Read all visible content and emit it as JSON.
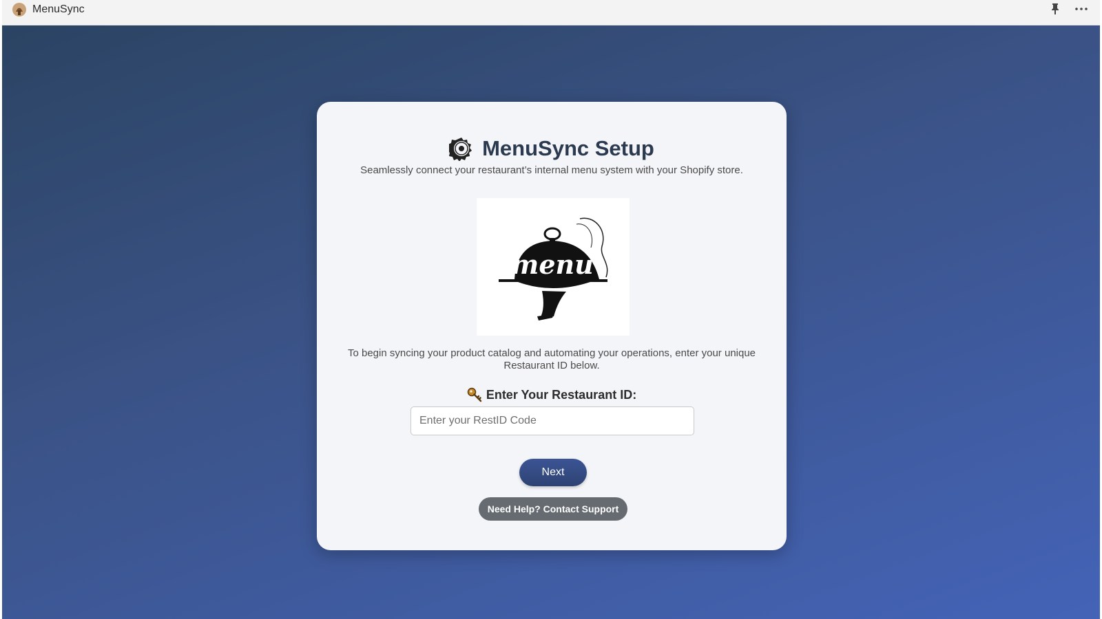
{
  "window": {
    "title": "MenuSync",
    "logo_icon": "app-logo-icon",
    "pin_icon": "pin-icon",
    "more_icon": "more-options-icon"
  },
  "setup": {
    "heading_icon": "gear-icon",
    "heading": "MenuSync Setup",
    "subtitle": "Seamlessly connect your restaurant’s internal menu system with your Shopify store.",
    "logo_image": "menu-cloche-logo",
    "logo_text": "menu",
    "intro_line1": "To begin syncing your product catalog and automating your operations, enter your unique",
    "intro_line2": "Restaurant ID below.",
    "id_label_icon": "key-icon",
    "id_label": "Enter Your Restaurant ID:",
    "id_input": {
      "value": "",
      "placeholder": "Enter your RestID Code"
    },
    "next_label": "Next",
    "support_label": "Need Help? Contact Support"
  },
  "colors": {
    "background_start": "#2b4463",
    "background_end": "#4463b7",
    "primary_button": "#3b5494",
    "secondary_button": "#666b72",
    "heading_text": "#2c3a50"
  }
}
